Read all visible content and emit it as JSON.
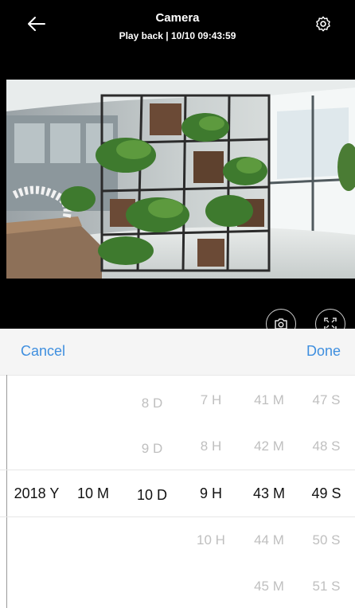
{
  "header": {
    "title": "Camera",
    "subtitle": "Play back | 10/10 09:43:59"
  },
  "picker": {
    "cancel_label": "Cancel",
    "done_label": "Done",
    "columns": {
      "year": {
        "above": [
          "",
          ""
        ],
        "selected": "2018 Y",
        "below": [
          "",
          ""
        ]
      },
      "month": {
        "above": [
          "",
          ""
        ],
        "selected": "10 M",
        "below": [
          "",
          ""
        ]
      },
      "day": {
        "above": [
          "8 D",
          "9 D"
        ],
        "selected": "10 D",
        "below": [
          "",
          ""
        ]
      },
      "hour": {
        "above": [
          "7 H",
          "8 H"
        ],
        "selected": "9 H",
        "below": [
          "10 H",
          ""
        ]
      },
      "minute": {
        "above": [
          "41 M",
          "42 M"
        ],
        "selected": "43 M",
        "below": [
          "44 M",
          "45 M"
        ]
      },
      "second": {
        "above": [
          "47 S",
          "48 S"
        ],
        "selected": "49 S",
        "below": [
          "50 S",
          "51 S"
        ]
      }
    }
  },
  "colors": {
    "accent": "#3f8fdf",
    "header_bg": "#000000",
    "sheet_bar_bg": "#f5f5f5"
  },
  "icons": {
    "back": "arrow-left-icon",
    "settings": "gear-icon",
    "snapshot": "camera-icon",
    "fullscreen": "fullscreen-icon"
  }
}
